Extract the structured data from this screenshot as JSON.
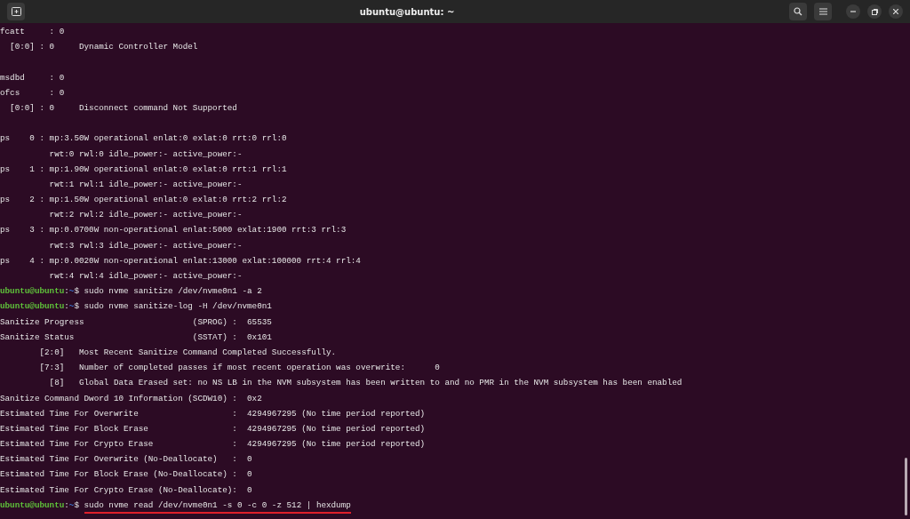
{
  "window": {
    "title": "ubuntu@ubuntu: ~"
  },
  "terminal": {
    "lines": [
      {
        "kind": "output",
        "text": "fcatt     : 0"
      },
      {
        "kind": "output",
        "text": "  [0:0] : 0     Dynamic Controller Model"
      },
      {
        "kind": "blank"
      },
      {
        "kind": "output",
        "text": "msdbd     : 0"
      },
      {
        "kind": "output",
        "text": "ofcs      : 0"
      },
      {
        "kind": "output",
        "text": "  [0:0] : 0     Disconnect command Not Supported"
      },
      {
        "kind": "blank"
      },
      {
        "kind": "output",
        "text": "ps    0 : mp:3.50W operational enlat:0 exlat:0 rrt:0 rrl:0"
      },
      {
        "kind": "output",
        "text": "          rwt:0 rwl:0 idle_power:- active_power:-"
      },
      {
        "kind": "output",
        "text": "ps    1 : mp:1.90W operational enlat:0 exlat:0 rrt:1 rrl:1"
      },
      {
        "kind": "output",
        "text": "          rwt:1 rwl:1 idle_power:- active_power:-"
      },
      {
        "kind": "output",
        "text": "ps    2 : mp:1.50W operational enlat:0 exlat:0 rrt:2 rrl:2"
      },
      {
        "kind": "output",
        "text": "          rwt:2 rwl:2 idle_power:- active_power:-"
      },
      {
        "kind": "output",
        "text": "ps    3 : mp:0.0700W non-operational enlat:5000 exlat:1900 rrt:3 rrl:3"
      },
      {
        "kind": "output",
        "text": "          rwt:3 rwl:3 idle_power:- active_power:-"
      },
      {
        "kind": "output",
        "text": "ps    4 : mp:0.0020W non-operational enlat:13000 exlat:100000 rrt:4 rrl:4"
      },
      {
        "kind": "output",
        "text": "          rwt:4 rwl:4 idle_power:- active_power:-"
      },
      {
        "kind": "prompt",
        "user_host": "ubuntu@ubuntu",
        "separator": ":",
        "path": "~",
        "symbol": "$",
        "command": "sudo nvme sanitize /dev/nvme0n1 -a 2",
        "highlighted": false
      },
      {
        "kind": "prompt",
        "user_host": "ubuntu@ubuntu",
        "separator": ":",
        "path": "~",
        "symbol": "$",
        "command": "sudo nvme sanitize-log -H /dev/nvme0n1",
        "highlighted": false
      },
      {
        "kind": "output",
        "text": "Sanitize Progress                      (SPROG) :  65535"
      },
      {
        "kind": "output",
        "text": "Sanitize Status                        (SSTAT) :  0x101"
      },
      {
        "kind": "output",
        "text": "        [2:0]   Most Recent Sanitize Command Completed Successfully."
      },
      {
        "kind": "output",
        "text": "        [7:3]   Number of completed passes if most recent operation was overwrite:      0"
      },
      {
        "kind": "output",
        "text": "          [8]   Global Data Erased set: no NS LB in the NVM subsystem has been written to and no PMR in the NVM subsystem has been enabled"
      },
      {
        "kind": "output",
        "text": "Sanitize Command Dword 10 Information (SCDW10) :  0x2"
      },
      {
        "kind": "output",
        "text": "Estimated Time For Overwrite                   :  4294967295 (No time period reported)"
      },
      {
        "kind": "output",
        "text": "Estimated Time For Block Erase                 :  4294967295 (No time period reported)"
      },
      {
        "kind": "output",
        "text": "Estimated Time For Crypto Erase                :  4294967295 (No time period reported)"
      },
      {
        "kind": "output",
        "text": "Estimated Time For Overwrite (No-Deallocate)   :  0"
      },
      {
        "kind": "output",
        "text": "Estimated Time For Block Erase (No-Deallocate) :  0"
      },
      {
        "kind": "output",
        "text": "Estimated Time For Crypto Erase (No-Deallocate):  0"
      },
      {
        "kind": "prompt",
        "user_host": "ubuntu@ubuntu",
        "separator": ":",
        "path": "~",
        "symbol": "$",
        "command": "sudo nvme read /dev/nvme0n1 -s 0 -c 0 -z 512 | hexdump",
        "highlighted": true
      }
    ]
  }
}
